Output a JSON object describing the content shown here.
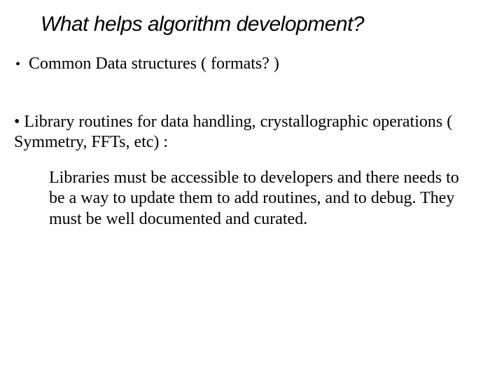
{
  "title": "What helps algorithm development?",
  "bullet1": {
    "marker": "•",
    "text": "Common Data structures ( formats? )"
  },
  "bullet2": {
    "text": "• Library routines for data handling, crystallographic operations ( Symmetry, FFTs, etc)  :"
  },
  "body": {
    "text": "Libraries must be accessible to developers and there needs to be a way to update them to add routines, and to debug. They must be well documented and curated."
  }
}
